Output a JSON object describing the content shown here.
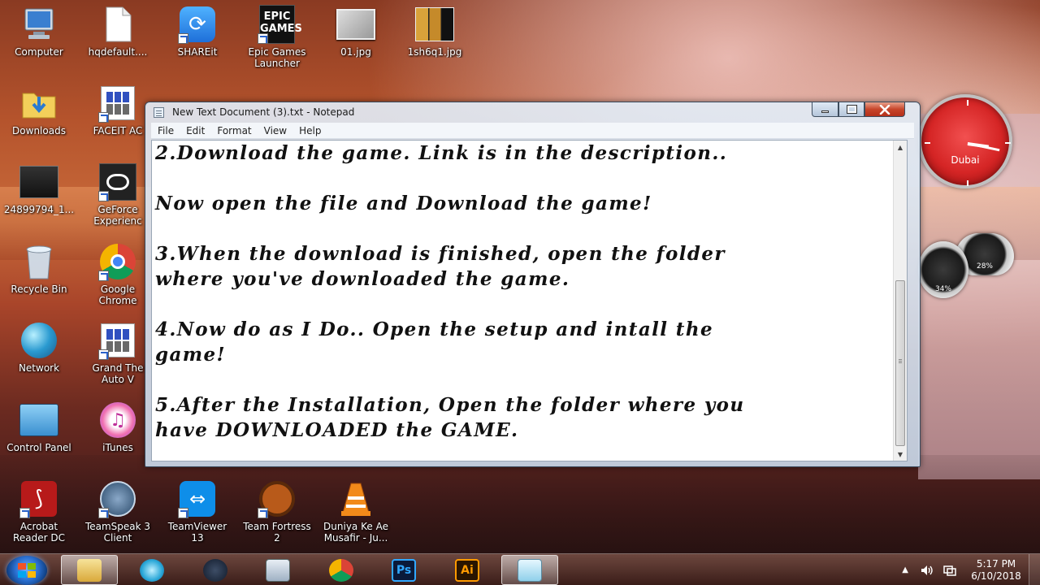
{
  "desktop": {
    "icons": [
      {
        "label": "Computer"
      },
      {
        "label": "hqdefault...."
      },
      {
        "label": "SHAREit"
      },
      {
        "label": "Epic Games\nLauncher"
      },
      {
        "label": "01.jpg"
      },
      {
        "label": "1sh6q1.jpg"
      },
      {
        "label": "Downloads"
      },
      {
        "label": "FACEIT AC"
      },
      {
        "label": "24899794_1..."
      },
      {
        "label": "GeForce\nExperienc"
      },
      {
        "label": "Recycle Bin"
      },
      {
        "label": "Google\nChrome"
      },
      {
        "label": "Network"
      },
      {
        "label": "Grand The\nAuto V"
      },
      {
        "label": "Control Panel"
      },
      {
        "label": "iTunes"
      },
      {
        "label": "Acrobat\nReader DC"
      },
      {
        "label": "TeamSpeak 3\nClient"
      },
      {
        "label": "TeamViewer\n13"
      },
      {
        "label": "Team Fortress\n2"
      },
      {
        "label": "Duniya Ke Ae\nMusafir - Ju..."
      }
    ],
    "epic_logo_text": "EPIC\nGAMES"
  },
  "notepad": {
    "title": "New Text Document (3).txt - Notepad",
    "menu": [
      "File",
      "Edit",
      "Format",
      "View",
      "Help"
    ],
    "content": "2.Download the game. Link is in the description..\n\nNow open the file and Download the game!\n\n3.When the download is finished, open the folder\nwhere you've downloaded the game.\n\n4.Now do as I Do.. Open the setup and intall the\ngame!\n\n5.After the Installation, Open the folder where you\nhave DOWNLOADED the GAME."
  },
  "gadgets": {
    "clock_city": "Dubai",
    "cpu_meter": "28%",
    "ram_meter": "34%"
  },
  "taskbar": {
    "photoshop_label": "Ps",
    "illustrator_label": "Ai",
    "time": "5:17 PM",
    "date": "6/10/2018"
  }
}
